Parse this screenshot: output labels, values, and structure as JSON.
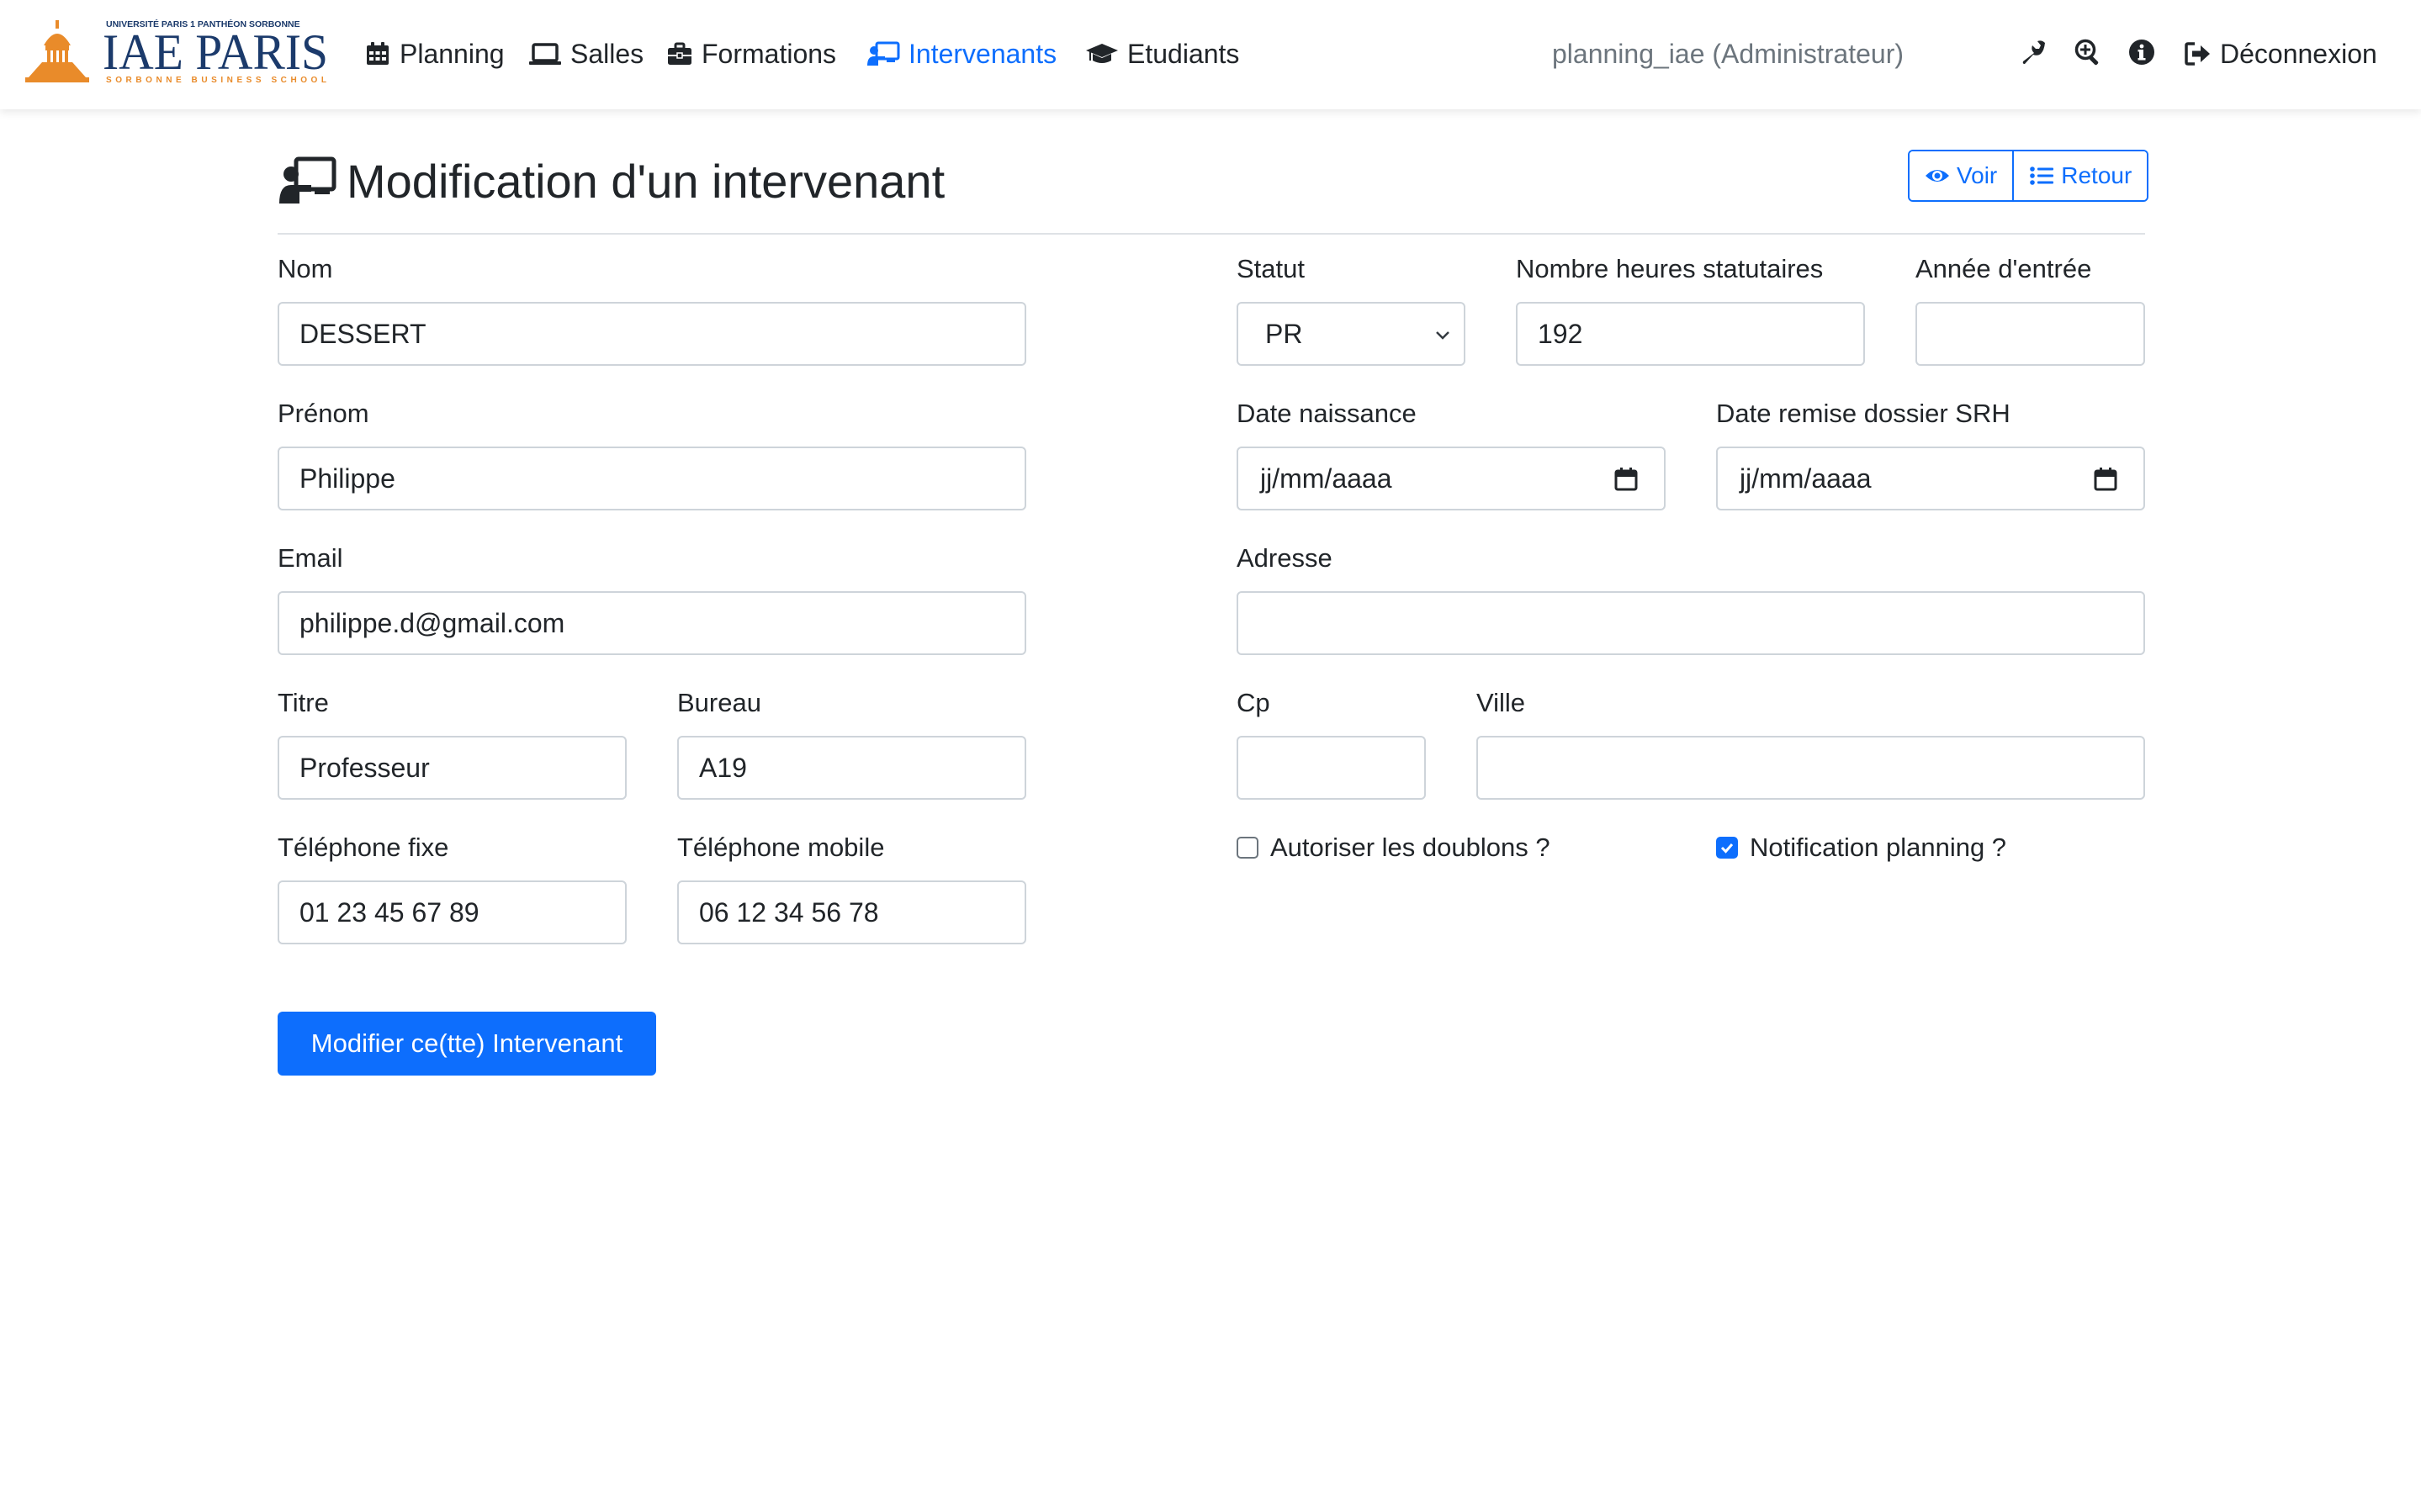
{
  "navbar": {
    "logo": {
      "top_text": "UNIVERSITÉ PARIS 1 PANTHÉON SORBONNE",
      "main_text": "IAE PARIS",
      "bottom_text": "SORBONNE BUSINESS SCHOOL"
    },
    "items": [
      {
        "label": "Planning",
        "icon": "calendar-icon",
        "active": false
      },
      {
        "label": "Salles",
        "icon": "laptop-icon",
        "active": false
      },
      {
        "label": "Formations",
        "icon": "briefcase-icon",
        "active": false
      },
      {
        "label": "Intervenants",
        "icon": "chalkboard-teacher-icon",
        "active": true
      },
      {
        "label": "Etudiants",
        "icon": "graduation-cap-icon",
        "active": false
      }
    ],
    "user": "planning_iae (Administrateur)",
    "tools": [
      "wrench-icon",
      "search-plus-icon",
      "info-circle-icon"
    ],
    "logout": "Déconnexion"
  },
  "header": {
    "title": "Modification d'un intervenant",
    "view_label": "Voir",
    "back_label": "Retour"
  },
  "form": {
    "nom": {
      "label": "Nom",
      "value": "DESSERT"
    },
    "prenom": {
      "label": "Prénom",
      "value": "Philippe"
    },
    "email": {
      "label": "Email",
      "value": "philippe.d@gmail.com"
    },
    "titre": {
      "label": "Titre",
      "value": "Professeur"
    },
    "bureau": {
      "label": "Bureau",
      "value": "A19"
    },
    "tel_fixe": {
      "label": "Téléphone fixe",
      "value": "01 23 45 67 89"
    },
    "tel_mobile": {
      "label": "Téléphone mobile",
      "value": "06 12 34 56 78"
    },
    "statut": {
      "label": "Statut",
      "value": "PR"
    },
    "heures": {
      "label": "Nombre heures statutaires",
      "value": "192"
    },
    "annee_entree": {
      "label": "Année d'entrée",
      "value": ""
    },
    "date_naissance": {
      "label": "Date naissance",
      "value": "jj/mm/aaaa"
    },
    "date_remise": {
      "label": "Date remise dossier SRH",
      "value": "jj/mm/aaaa"
    },
    "adresse": {
      "label": "Adresse",
      "value": ""
    },
    "cp": {
      "label": "Cp",
      "value": ""
    },
    "ville": {
      "label": "Ville",
      "value": ""
    },
    "doublons": {
      "label": "Autoriser les doublons ?",
      "checked": false
    },
    "notification": {
      "label": "Notification planning ?",
      "checked": true
    },
    "submit_label": "Modifier ce(tte) Intervenant"
  },
  "colors": {
    "primary": "#0d6efd",
    "logo_orange": "#e98b2a",
    "logo_navy": "#1b3a6b",
    "muted": "#6c757d"
  }
}
